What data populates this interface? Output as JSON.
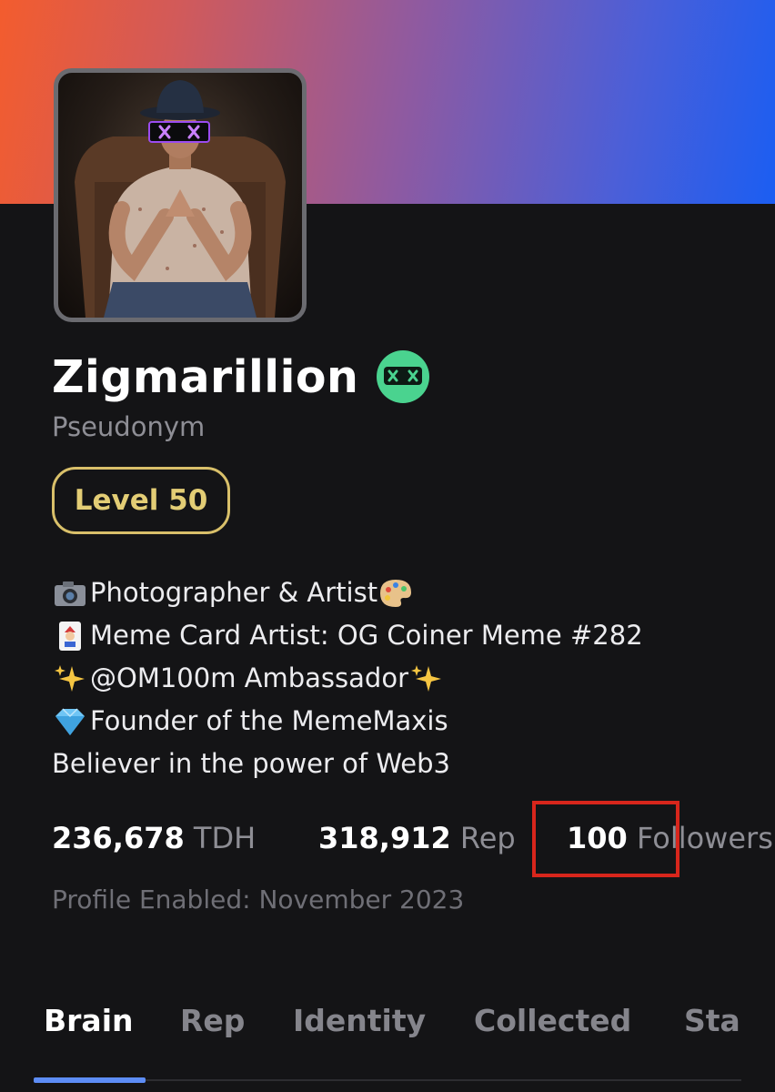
{
  "profile": {
    "name": "Zigmarillion",
    "pseudonym": "Pseudonym",
    "level": "Level 50",
    "bio": [
      {
        "icon": "camera-icon",
        "text": "Photographer & Artist",
        "trailing_icon": "palette-icon"
      },
      {
        "icon": "joker-card-icon",
        "text": "Meme Card Artist: OG Coiner Meme #282"
      },
      {
        "icon": "sparkles-icon",
        "text": "@OM100m Ambassador",
        "trailing_icon": "sparkles-icon"
      },
      {
        "icon": "gem-icon",
        "text": "Founder of the MemeMaxis"
      },
      {
        "icon": "",
        "text": "Believer in the power of Web3"
      }
    ],
    "stats": {
      "tdh_value": "236,678",
      "tdh_label": "TDH",
      "rep_value": "318,912",
      "rep_label": "Rep",
      "followers_value": "100",
      "followers_label": "Followers"
    },
    "profile_enabled": "Profile Enabled: November 2023"
  },
  "tabs": [
    {
      "label": "Brain",
      "active": true
    },
    {
      "label": "Rep",
      "active": false
    },
    {
      "label": "Identity",
      "active": false
    },
    {
      "label": "Collected",
      "active": false
    },
    {
      "label": "Sta",
      "active": false
    }
  ],
  "colors": {
    "background": "#141416",
    "level_accent": "#e3cd75",
    "badge_green": "#4ad38f",
    "tab_indicator": "#5d8df6",
    "highlight_box": "#d8261c"
  }
}
